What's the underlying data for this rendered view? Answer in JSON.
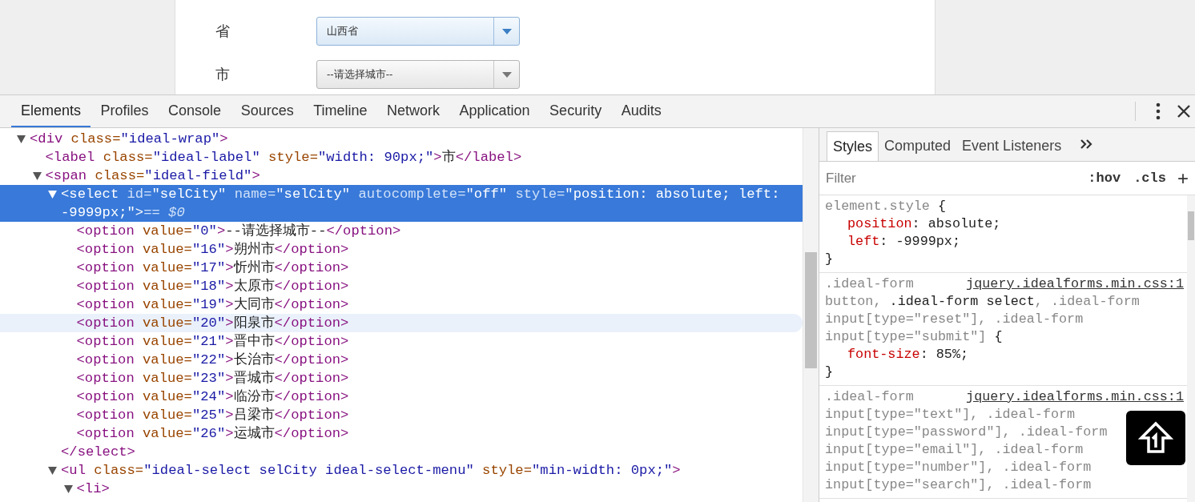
{
  "page": {
    "fields": [
      {
        "label": "省",
        "value": "山西省",
        "focused": true
      },
      {
        "label": "市",
        "value": "--请选择城市--",
        "focused": false
      }
    ]
  },
  "devtools": {
    "tabs": [
      {
        "label": "Elements",
        "selected": true
      },
      {
        "label": "Profiles",
        "selected": false
      },
      {
        "label": "Console",
        "selected": false
      },
      {
        "label": "Sources",
        "selected": false
      },
      {
        "label": "Timeline",
        "selected": false
      },
      {
        "label": "Network",
        "selected": false
      },
      {
        "label": "Application",
        "selected": false
      },
      {
        "label": "Security",
        "selected": false
      },
      {
        "label": "Audits",
        "selected": false
      }
    ],
    "dom_tree": [
      {
        "open": "<div class=\"ideal-wrap\">",
        "expanded": true,
        "selected": false,
        "hovered": false,
        "children": [
          {
            "open": "<label class=\"ideal-label\" style=\"width: 90px;\">市</label>",
            "selected": false,
            "hovered": false
          },
          {
            "open": "<span class=\"ideal-field\">",
            "expanded": true,
            "selected": false,
            "hovered": false,
            "children": [
              {
                "open": "<select id=\"selCity\" name=\"selCity\" autocomplete=\"off\" style=\"position: absolute; left: -9999px;\">",
                "console_ref": "== $0",
                "expanded": true,
                "selected": true,
                "hovered": false,
                "close": "</select>",
                "children": [
                  {
                    "open": "<option value=\"0\">--请选择城市--</option>",
                    "selected": false,
                    "hovered": false
                  },
                  {
                    "open": "<option value=\"16\">朔州市</option>",
                    "selected": false,
                    "hovered": false
                  },
                  {
                    "open": "<option value=\"17\">忻州市</option>",
                    "selected": false,
                    "hovered": false
                  },
                  {
                    "open": "<option value=\"18\">太原市</option>",
                    "selected": false,
                    "hovered": false
                  },
                  {
                    "open": "<option value=\"19\">大同市</option>",
                    "selected": false,
                    "hovered": false
                  },
                  {
                    "open": "<option value=\"20\">阳泉市</option>",
                    "selected": false,
                    "hovered": true
                  },
                  {
                    "open": "<option value=\"21\">晋中市</option>",
                    "selected": false,
                    "hovered": false
                  },
                  {
                    "open": "<option value=\"22\">长治市</option>",
                    "selected": false,
                    "hovered": false
                  },
                  {
                    "open": "<option value=\"23\">晋城市</option>",
                    "selected": false,
                    "hovered": false
                  },
                  {
                    "open": "<option value=\"24\">临汾市</option>",
                    "selected": false,
                    "hovered": false
                  },
                  {
                    "open": "<option value=\"25\">吕梁市</option>",
                    "selected": false,
                    "hovered": false
                  },
                  {
                    "open": "<option value=\"26\">运城市</option>",
                    "selected": false,
                    "hovered": false
                  }
                ]
              },
              {
                "open": "<ul class=\"ideal-select selCity ideal-select-menu\" style=\"min-width: 0px;\">",
                "expanded": true,
                "selected": false,
                "hovered": false,
                "children": [
                  {
                    "open": "<li>",
                    "expanded": true,
                    "selected": false,
                    "hovered": false
                  }
                ]
              }
            ]
          }
        ]
      }
    ],
    "sidebar_tabs": [
      {
        "label": "Styles",
        "selected": true
      },
      {
        "label": "Computed",
        "selected": false
      },
      {
        "label": "Event Listeners",
        "selected": false
      }
    ],
    "filter": {
      "placeholder": "Filter",
      "buttons": [
        ":hov",
        ".cls",
        "+"
      ]
    },
    "rules": [
      {
        "selector_lines": [
          [
            {
              "text": "element.style",
              "matched": false
            }
          ]
        ],
        "open_brace": "{",
        "declarations": [
          {
            "property": "position",
            "value": ": absolute;"
          },
          {
            "property": "left",
            "value": ": -9999px;"
          }
        ],
        "close_brace": "}"
      },
      {
        "source": "jquery.idealforms.min.css:1",
        "selector_lines": [
          [
            {
              "text": ".ideal-form",
              "matched": false
            }
          ],
          [
            {
              "text": "button, ",
              "matched": false
            },
            {
              "text": ".ideal-form select",
              "matched": true
            },
            {
              "text": ", .ideal-form",
              "matched": false
            }
          ],
          [
            {
              "text": "input[type=\"reset\"], .ideal-form",
              "matched": false
            }
          ],
          [
            {
              "text": "input[type=\"submit\"]",
              "matched": false
            }
          ]
        ],
        "open_brace": "{",
        "declarations": [
          {
            "property": "font-size",
            "value": ": 85%;"
          }
        ],
        "close_brace": "}"
      },
      {
        "source": "jquery.idealforms.min.css:1",
        "selector_lines": [
          [
            {
              "text": ".ideal-form",
              "matched": false
            }
          ],
          [
            {
              "text": "input[type=\"text\"], .ideal-form",
              "matched": false
            }
          ],
          [
            {
              "text": "input[type=\"password\"], .ideal-form",
              "matched": false
            }
          ],
          [
            {
              "text": "input[type=\"email\"], .ideal-form",
              "matched": false
            }
          ],
          [
            {
              "text": "input[type=\"number\"], .ideal-form",
              "matched": false
            }
          ],
          [
            {
              "text": "input[type=\"search\"], .ideal-form",
              "matched": false
            }
          ]
        ]
      }
    ]
  }
}
